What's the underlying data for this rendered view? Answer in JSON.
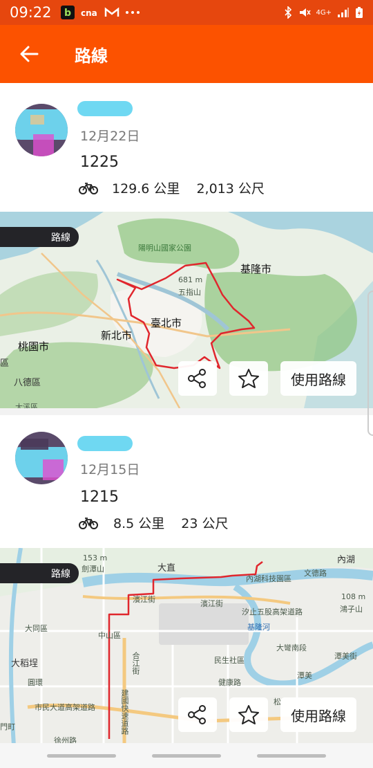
{
  "status": {
    "time": "09:22",
    "network_text": "4G+"
  },
  "appbar": {
    "title": "路線"
  },
  "routes": [
    {
      "date": "12月22日",
      "name": "1225",
      "distance": "129.6 公里",
      "elevation": "2,013 公尺",
      "map_tag": "路線",
      "share_icon": "share-icon",
      "star_icon": "star-icon",
      "use_route_label": "使用路線",
      "map_labels": {
        "park": "陽明山國家公園",
        "keelung": "基隆市",
        "peak_elev": "681 m",
        "peak_name": "五指山",
        "taipei": "臺北市",
        "newtaipei": "新北市",
        "taoyuan": "桃園市",
        "district": "區",
        "bade": "八德區",
        "daxi": "大溪區"
      }
    },
    {
      "date": "12月15日",
      "name": "1215",
      "distance": "8.5 公里",
      "elevation": "23 公尺",
      "map_tag": "路線",
      "use_route_label": "使用路線",
      "map_labels": {
        "jiantan_elev": "153 m",
        "jiantan": "劍潭山",
        "dazhi": "大直",
        "neihu": "內湖",
        "tech_park": "內湖科技園區",
        "wende": "文德路",
        "binjiang1": "濱江街",
        "binjiang2": "濱江街",
        "highway": "汐止五股高架道路",
        "elev108": "108 m",
        "mt": "鴻子山",
        "datong": "大同區",
        "zhongshan": "中山區",
        "keelung_river": "基隆河",
        "dawan": "大彎南段",
        "hejiang": "合江街",
        "minsheng": "民生社區",
        "dadaocheng": "大稻埕",
        "jianguo": "建國快速道路",
        "jiankang": "健康路",
        "tanmei": "潭美",
        "tanmei_st": "潭美街",
        "yuan": "圓環",
        "civic": "市民大道高架道路",
        "song": "松",
        "ximen": "門町",
        "xuzhou": "徐州路"
      }
    }
  ]
}
